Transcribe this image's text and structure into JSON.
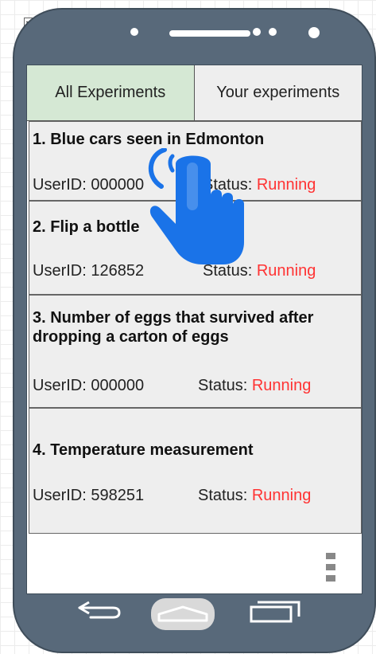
{
  "tabs": [
    {
      "label": "All Experiments",
      "active": true
    },
    {
      "label": "Your experiments",
      "active": false
    }
  ],
  "experiments": [
    {
      "title": "1. Blue cars seen in Edmonton",
      "user_label": "UserID: 000000",
      "status_label": "Status:",
      "status_value": "Running"
    },
    {
      "title": "2. Flip a bottle",
      "user_label": "UserID: 126852",
      "status_label": "Status:",
      "status_value": "Running"
    },
    {
      "title": "3. Number of eggs that survived after dropping a carton of eggs",
      "user_label": "UserID: 000000",
      "status_label": "Status:",
      "status_value": "Running"
    },
    {
      "title": "4. Temperature measurement",
      "user_label": "UserID: 598251",
      "status_label": "Status:",
      "status_value": "Running"
    }
  ],
  "icons": {
    "collapse": "collapse-icon",
    "menu": "more-vertical-icon",
    "back": "back-arrow-icon",
    "home": "home-icon",
    "recent": "recent-apps-icon",
    "touch": "tap-gesture-icon"
  },
  "colors": {
    "phone_body": "#58697a",
    "tab_active": "#d5e8d4",
    "card_background": "#eeeeee",
    "status_running": "#ff3333",
    "touch_icon": "#1a73e8"
  }
}
